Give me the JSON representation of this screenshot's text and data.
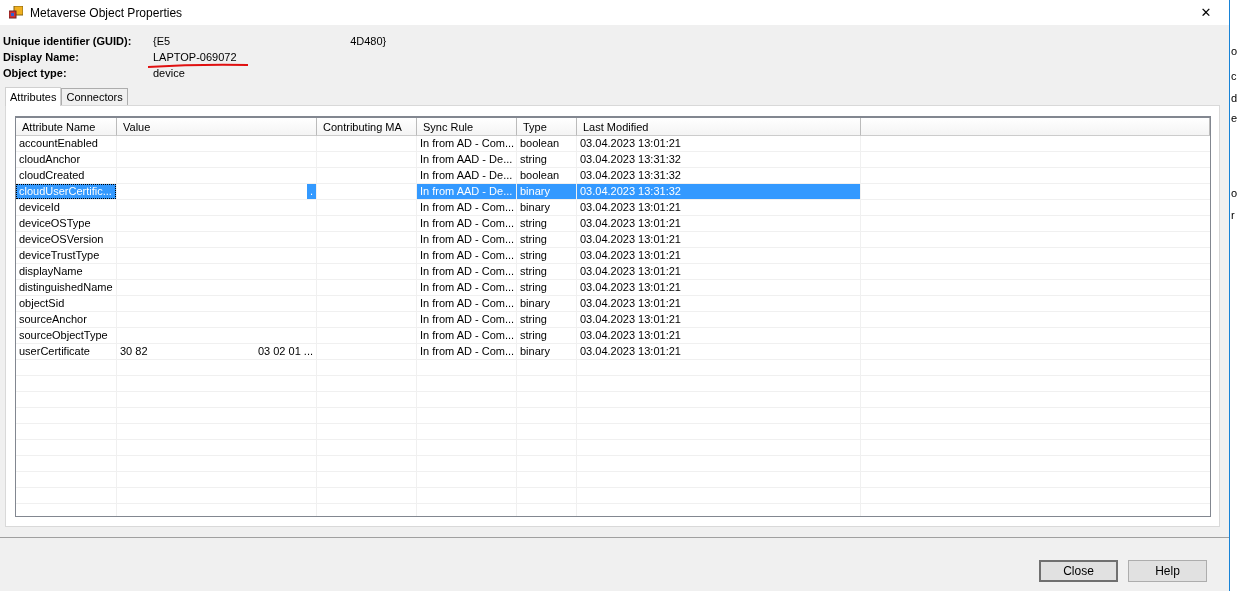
{
  "window": {
    "title": "Metaverse Object Properties",
    "close_glyph": "✕"
  },
  "header": [
    {
      "label": "Unique identifier (GUID):",
      "value": [
        "{E5",
        "4D480}"
      ]
    },
    {
      "label": "Display Name:",
      "value": [
        "LAPTOP-069072"
      ],
      "underlined": true
    },
    {
      "label": "Object type:",
      "value": [
        "device"
      ]
    }
  ],
  "tabs": [
    {
      "label": "Attributes",
      "selected": true
    },
    {
      "label": "Connectors",
      "selected": false
    }
  ],
  "table": {
    "columns": [
      "Attribute Name",
      "Value",
      "Contributing MA",
      "Sync Rule",
      "Type",
      "Last Modified"
    ],
    "rows": [
      {
        "name": "accountEnabled",
        "sync_rule": "In from AD - Com...",
        "type": "boolean",
        "modified": "03.04.2023 13:01:21",
        "selected": false
      },
      {
        "name": "cloudAnchor",
        "sync_rule": "In from AAD - De...",
        "type": "string",
        "modified": "03.04.2023 13:31:32",
        "selected": false
      },
      {
        "name": "cloudCreated",
        "sync_rule": "In from AAD - De...",
        "type": "boolean",
        "modified": "03.04.2023 13:31:32",
        "selected": false
      },
      {
        "name": "cloudUserCertific...",
        "value": [
          "."
        ],
        "sync_rule": "In from AAD - De...",
        "type": "binary",
        "modified": "03.04.2023 13:31:32",
        "selected": true
      },
      {
        "name": "deviceId",
        "sync_rule": "In from AD - Com...",
        "type": "binary",
        "modified": "03.04.2023 13:01:21",
        "selected": false
      },
      {
        "name": "deviceOSType",
        "sync_rule": "In from AD - Com...",
        "type": "string",
        "modified": "03.04.2023 13:01:21",
        "selected": false
      },
      {
        "name": "deviceOSVersion",
        "sync_rule": "In from AD - Com...",
        "type": "string",
        "modified": "03.04.2023 13:01:21",
        "selected": false
      },
      {
        "name": "deviceTrustType",
        "sync_rule": "In from AD - Com...",
        "type": "string",
        "modified": "03.04.2023 13:01:21",
        "selected": false
      },
      {
        "name": "displayName",
        "sync_rule": "In from AD - Com...",
        "type": "string",
        "modified": "03.04.2023 13:01:21",
        "selected": false
      },
      {
        "name": "distinguishedName",
        "sync_rule": "In from AD - Com...",
        "type": "string",
        "modified": "03.04.2023 13:01:21",
        "selected": false
      },
      {
        "name": "objectSid",
        "sync_rule": "In from AD - Com...",
        "type": "binary",
        "modified": "03.04.2023 13:01:21",
        "selected": false
      },
      {
        "name": "sourceAnchor",
        "sync_rule": "In from AD - Com...",
        "type": "string",
        "modified": "03.04.2023 13:01:21",
        "selected": false
      },
      {
        "name": "sourceObjectType",
        "sync_rule": "In from AD - Com...",
        "type": "string",
        "modified": "03.04.2023 13:01:21",
        "selected": false
      },
      {
        "name": "userCertificate",
        "value": [
          "30 82",
          "03 02 01 ..."
        ],
        "sync_rule": "In from AD - Com...",
        "type": "binary",
        "modified": "03.04.2023 13:01:21",
        "selected": false
      }
    ]
  },
  "buttons": [
    "Close",
    "Help"
  ],
  "background_window": [
    "o",
    "c",
    "d",
    "e",
    "o",
    "r"
  ]
}
